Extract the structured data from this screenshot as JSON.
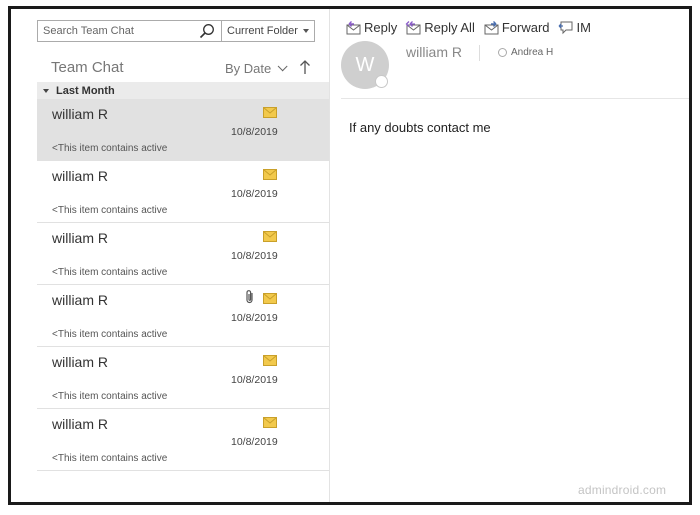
{
  "search": {
    "placeholder": "Search Team Chat",
    "scope": "Current Folder"
  },
  "list": {
    "title": "Team Chat",
    "sort_label": "By Date",
    "group_label": "Last Month",
    "items": [
      {
        "sender": "william R",
        "preview": "<This item contains active",
        "date": "10/8/2019",
        "attachment": false,
        "selected": true
      },
      {
        "sender": "william R",
        "preview": "<This item contains active",
        "date": "10/8/2019",
        "attachment": false,
        "selected": false
      },
      {
        "sender": "william R",
        "preview": "<This item contains active",
        "date": "10/8/2019",
        "attachment": false,
        "selected": false
      },
      {
        "sender": "william R",
        "preview": "<This item contains active",
        "date": "10/8/2019",
        "attachment": true,
        "selected": false
      },
      {
        "sender": "william R",
        "preview": "<This item contains active",
        "date": "10/8/2019",
        "attachment": false,
        "selected": false
      },
      {
        "sender": "william R",
        "preview": "<This item contains active",
        "date": "10/8/2019",
        "attachment": false,
        "selected": false
      }
    ]
  },
  "reading": {
    "toolbar": {
      "reply": "Reply",
      "reply_all": "Reply All",
      "forward": "Forward",
      "im": "IM"
    },
    "avatar_initial": "W",
    "from": "william R",
    "to": "Andrea H",
    "body": "If any doubts contact me"
  },
  "watermark": "admindroid.com",
  "colors": {
    "selected_row": "#e1e1e1",
    "envelope": "#f2c94c",
    "toolbar_icon": "#4a6fb0"
  }
}
